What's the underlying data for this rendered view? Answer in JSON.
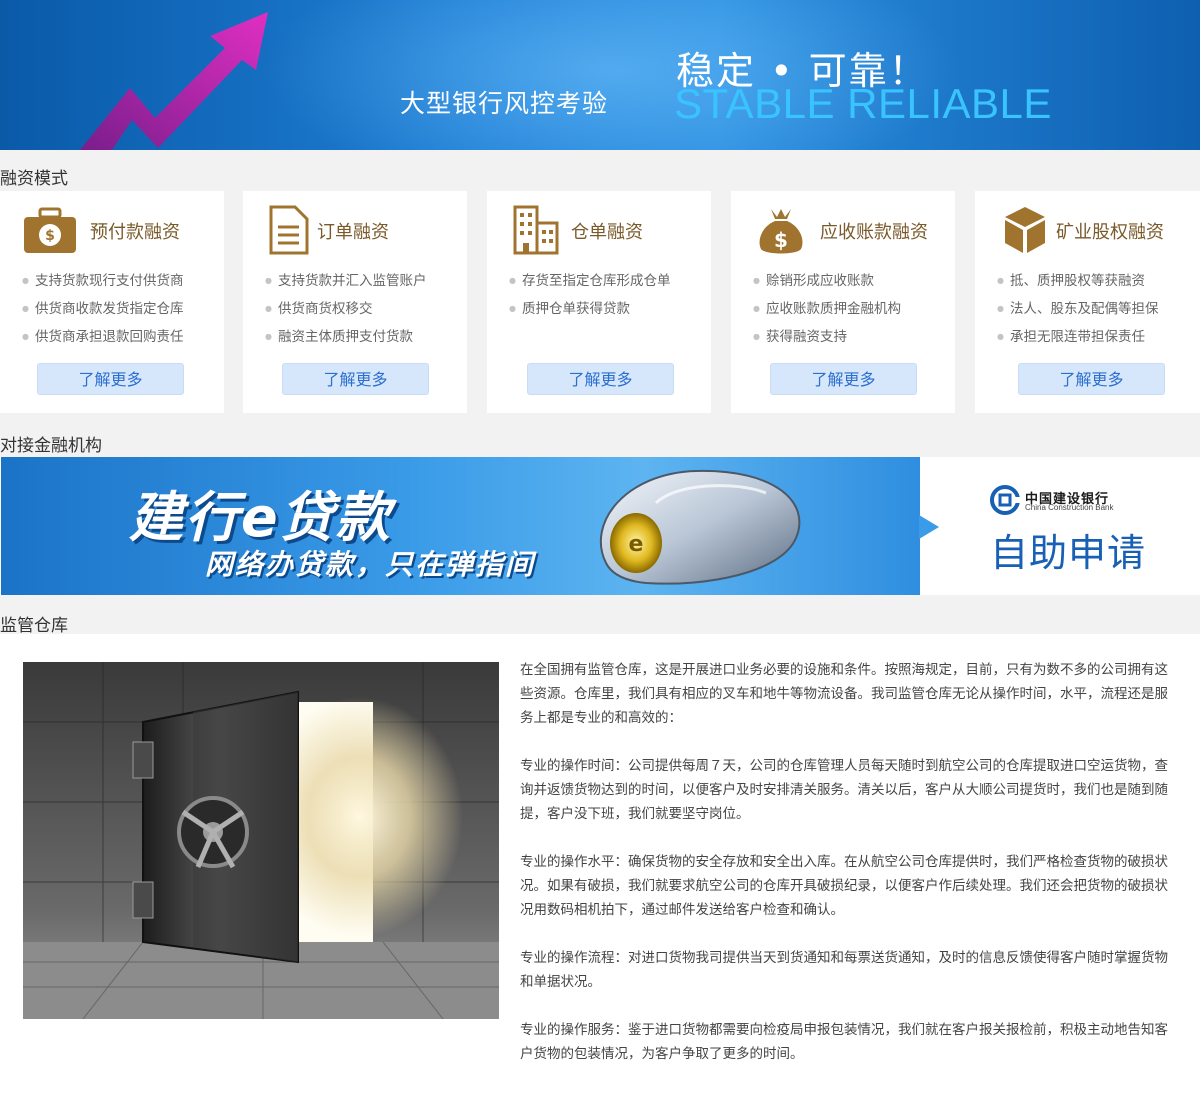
{
  "hero": {
    "subtitle": "大型银行风控考验",
    "title_cn": "稳定 • 可靠！",
    "title_en": "STABLE RELIABLE"
  },
  "sections": {
    "financing": "融资模式",
    "institutions": "对接金融机构",
    "warehouse": "监管仓库"
  },
  "cards": [
    {
      "title": "预付款融资",
      "icon": "money-bag-icon",
      "items": [
        "支持货款现行支付供货商",
        "供货商收款发货指定仓库",
        "供货商承担退款回购责任"
      ],
      "button": "了解更多"
    },
    {
      "title": "订单融资",
      "icon": "document-icon",
      "items": [
        "支持货款并汇入监管账户",
        "供货商货权移交",
        "融资主体质押支付货款"
      ],
      "button": "了解更多"
    },
    {
      "title": "仓单融资",
      "icon": "building-icon",
      "items": [
        "存货至指定仓库形成仓单",
        "质押仓单获得贷款"
      ],
      "button": "了解更多"
    },
    {
      "title": "应收账款融资",
      "icon": "dollar-sack-icon",
      "items": [
        "赊销形成应收账款",
        "应收账款质押金融机构",
        "获得融资支持"
      ],
      "button": "了解更多"
    },
    {
      "title": "矿业股权融资",
      "icon": "cube-icon",
      "items": [
        "抵、质押股权等获融资",
        "法人、股东及配偶等担保",
        "承担无限连带担保责任"
      ],
      "button": "了解更多"
    }
  ],
  "banner": {
    "title": "建行e贷款",
    "slogan": "网络办贷款，只在弹指间",
    "bank_name_cn": "中国建设银行",
    "bank_name_en": "China Construction Bank",
    "apply_label": "自助申请"
  },
  "warehouse_text": [
    "在全国拥有监管仓库，这是开展进口业务必要的设施和条件。按照海规定，目前，只有为数不多的公司拥有这些资源。仓库里，我们具有相应的叉车和地牛等物流设备。我司监管仓库无论从操作时间，水平，流程还是服务上都是专业的和高效的：",
    "专业的操作时间：公司提供每周７天，公司的仓库管理人员每天随时到航空公司的仓库提取进口空运货物，查询并返馈货物达到的时间，以便客户及时安排清关服务。清关以后，客户从大顺公司提货时，我们也是随到随提，客户没下班，我们就要坚守岗位。",
    "专业的操作水平：确保货物的安全存放和安全出入库。在从航空公司仓库提供时，我们严格检查货物的破损状况。如果有破损，我们就要求航空公司的仓库开具破损纪录，以便客户作后续处理。我们还会把货物的破损状况用数码相机拍下，通过邮件发送给客户检查和确认。",
    "专业的操作流程：对进口货物我司提供当天到货通知和每票送货通知，及时的信息反馈使得客户随时掌握货物和单据状况。",
    "专业的操作服务：鉴于进口货物都需要向检疫局申报包装情况，我们就在客户报关报检前，积极主动地告知客户货物的包装情况，为客户争取了更多的时间。"
  ]
}
